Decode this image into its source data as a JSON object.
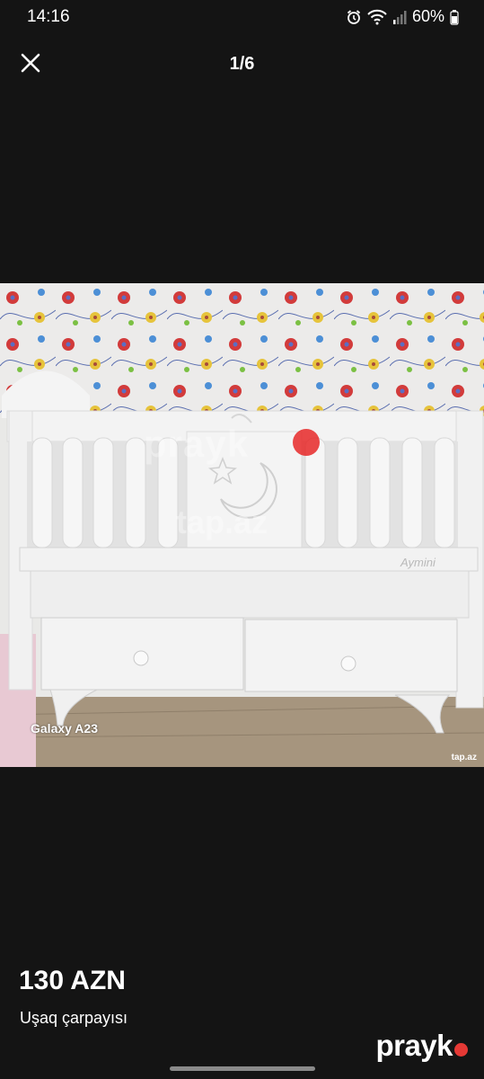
{
  "status_bar": {
    "time": "14:16",
    "battery_percent": "60%",
    "icons": [
      "alarm-icon",
      "wifi-icon",
      "signal-icon",
      "battery-icon"
    ]
  },
  "viewer": {
    "counter": "1/6",
    "close_icon": "close-icon"
  },
  "photo": {
    "camera_label": "Galaxy A23",
    "corner_watermark": "tap.az",
    "watermark_brand": "prayk",
    "watermark_site": "tap.az",
    "crib_brand": "Aymini"
  },
  "listing": {
    "price": "130 AZN",
    "title": "Uşaq çarpayısı"
  },
  "logo": {
    "text": "prayk",
    "accent_color": "#e53935"
  },
  "colors": {
    "background": "#141414",
    "accent": "#e53935"
  }
}
